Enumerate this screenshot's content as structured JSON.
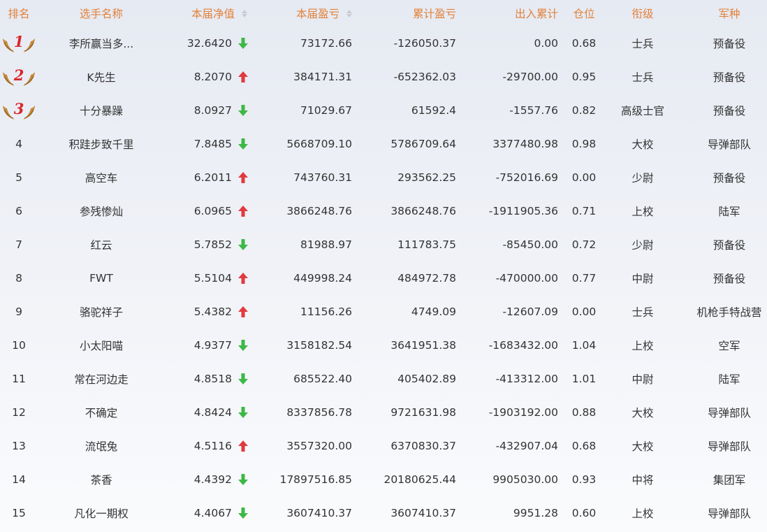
{
  "headers": {
    "rank": "排名",
    "name": "选手名称",
    "nav": "本届净值",
    "pl": "本届盈亏",
    "cum": "累计盈亏",
    "io": "出入累计",
    "pos": "仓位",
    "grade": "衔级",
    "corps": "军种"
  },
  "colors": {
    "header_text": "#e2813a",
    "arrow_up": "#e03a3e",
    "arrow_down": "#3db847",
    "medal_number": "#d9262a",
    "wing": "#c48a3c"
  },
  "rows": [
    {
      "rank": "1",
      "medal": true,
      "name": "李所赢当多...",
      "nav": "32.6420",
      "trend": "down",
      "pl": "73172.66",
      "cum": "-126050.37",
      "io": "0.00",
      "pos": "0.68",
      "grade": "士兵",
      "corps": "预备役"
    },
    {
      "rank": "2",
      "medal": true,
      "name": "K先生",
      "nav": "8.2070",
      "trend": "up",
      "pl": "384171.31",
      "cum": "-652362.03",
      "io": "-29700.00",
      "pos": "0.95",
      "grade": "士兵",
      "corps": "预备役"
    },
    {
      "rank": "3",
      "medal": true,
      "name": "十分暴躁",
      "nav": "8.0927",
      "trend": "down",
      "pl": "71029.67",
      "cum": "61592.4",
      "io": "-1557.76",
      "pos": "0.82",
      "grade": "高级士官",
      "corps": "预备役"
    },
    {
      "rank": "4",
      "medal": false,
      "name": "积跬步致千里",
      "nav": "7.8485",
      "trend": "down",
      "pl": "5668709.10",
      "cum": "5786709.64",
      "io": "3377480.98",
      "pos": "0.98",
      "grade": "大校",
      "corps": "导弹部队"
    },
    {
      "rank": "5",
      "medal": false,
      "name": "高空车",
      "nav": "6.2011",
      "trend": "up",
      "pl": "743760.31",
      "cum": "293562.25",
      "io": "-752016.69",
      "pos": "0.00",
      "grade": "少尉",
      "corps": "预备役"
    },
    {
      "rank": "6",
      "medal": false,
      "name": "参残惨灿",
      "nav": "6.0965",
      "trend": "up",
      "pl": "3866248.76",
      "cum": "3866248.76",
      "io": "-1911905.36",
      "pos": "0.71",
      "grade": "上校",
      "corps": "陆军"
    },
    {
      "rank": "7",
      "medal": false,
      "name": "红云",
      "nav": "5.7852",
      "trend": "down",
      "pl": "81988.97",
      "cum": "111783.75",
      "io": "-85450.00",
      "pos": "0.72",
      "grade": "少尉",
      "corps": "预备役"
    },
    {
      "rank": "8",
      "medal": false,
      "name": "FWT",
      "nav": "5.5104",
      "trend": "up",
      "pl": "449998.24",
      "cum": "484972.78",
      "io": "-470000.00",
      "pos": "0.77",
      "grade": "中尉",
      "corps": "预备役"
    },
    {
      "rank": "9",
      "medal": false,
      "name": "骆驼祥子",
      "nav": "5.4382",
      "trend": "up",
      "pl": "11156.26",
      "cum": "4749.09",
      "io": "-12607.09",
      "pos": "0.00",
      "grade": "士兵",
      "corps": "机枪手特战营"
    },
    {
      "rank": "10",
      "medal": false,
      "name": "小太阳喵",
      "nav": "4.9377",
      "trend": "down",
      "pl": "3158182.54",
      "cum": "3641951.38",
      "io": "-1683432.00",
      "pos": "1.04",
      "grade": "上校",
      "corps": "空军"
    },
    {
      "rank": "11",
      "medal": false,
      "name": "常在河边走",
      "nav": "4.8518",
      "trend": "down",
      "pl": "685522.40",
      "cum": "405402.89",
      "io": "-413312.00",
      "pos": "1.01",
      "grade": "中尉",
      "corps": "陆军"
    },
    {
      "rank": "12",
      "medal": false,
      "name": "不确定",
      "nav": "4.8424",
      "trend": "down",
      "pl": "8337856.78",
      "cum": "9721631.98",
      "io": "-1903192.00",
      "pos": "0.88",
      "grade": "大校",
      "corps": "导弹部队"
    },
    {
      "rank": "13",
      "medal": false,
      "name": "流氓兔",
      "nav": "4.5116",
      "trend": "up",
      "pl": "3557320.00",
      "cum": "6370830.37",
      "io": "-432907.04",
      "pos": "0.68",
      "grade": "大校",
      "corps": "导弹部队"
    },
    {
      "rank": "14",
      "medal": false,
      "name": "茶香",
      "nav": "4.4392",
      "trend": "down",
      "pl": "17897516.85",
      "cum": "20180625.44",
      "io": "9905030.00",
      "pos": "0.93",
      "grade": "中将",
      "corps": "集团军"
    },
    {
      "rank": "15",
      "medal": false,
      "name": "凡化一期权",
      "nav": "4.4067",
      "trend": "down",
      "pl": "3607410.37",
      "cum": "3607410.37",
      "io": "9951.28",
      "pos": "0.60",
      "grade": "上校",
      "corps": "导弹部队"
    }
  ]
}
